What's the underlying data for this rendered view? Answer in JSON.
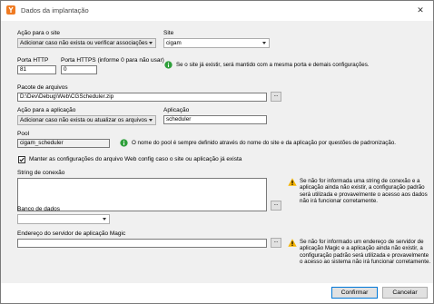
{
  "window": {
    "title": "Dados da implantação",
    "close_glyph": "✕"
  },
  "site_action": {
    "label": "Ação para o site",
    "value": "Adicionar caso não exista ou verificar associações"
  },
  "site": {
    "label": "Site",
    "value": "cigam"
  },
  "http_port": {
    "label": "Porta HTTP",
    "value": "81"
  },
  "https_port": {
    "label": "Porta HTTPS (informe 0 para não usar)",
    "value": "0"
  },
  "site_note": "Se o site já existir, será mantido com a mesma porta e demais configurações.",
  "package": {
    "label": "Pacote de arquivos",
    "value": "D:\\Dev\\Debug\\Web\\CGScheduler.zip",
    "browse_label": "..."
  },
  "app_action": {
    "label": "Ação para a aplicação",
    "value": "Adicionar caso não exista ou atualizar os arquivos"
  },
  "application": {
    "label": "Aplicação",
    "value": "scheduler"
  },
  "pool": {
    "label": "Pool",
    "value": "cigam_scheduler",
    "note": "O nome do pool é sempre definido através do nome do site e da aplicação por questões de padronização."
  },
  "keep_config": {
    "label": "Manter as configurações do arquivo Web config caso o site ou aplicação já exista",
    "checked": true
  },
  "connection_string": {
    "label": "String de conexão",
    "value": "",
    "browse_label": "...",
    "note_lines": [
      "Se não for informada uma string de conexão e a",
      "aplicação ainda não existir, a configuração padrão",
      "será utilizada e provavelmente o acesso aos dados",
      "não irá funcionar corretamente."
    ]
  },
  "database": {
    "label": "Banco de dados",
    "value": ""
  },
  "magic_server": {
    "label": "Endereço do servidor de aplicação Magic",
    "value": "",
    "browse_label": "...",
    "note_lines": [
      "Se não for informado um endereço de servidor de",
      "aplicação Magic e a aplicação ainda não existir, a",
      "configuração padrão será utilizada e provavelmente",
      "o acesso ao sistema não irá funcionar corretamente."
    ]
  },
  "buttons": {
    "confirm": "Confirmar",
    "cancel": "Cancelar"
  },
  "colors": {
    "info": "#2e9f3a",
    "warning": "#f5b400",
    "accent": "#f07b22",
    "primary_border": "#0078d7"
  },
  "icons": {
    "app": "app-logo-icon",
    "info": "info-circle-icon",
    "warning": "warning-triangle-icon",
    "check": "checkmark-icon",
    "dropdown": "chevron-down-icon"
  }
}
